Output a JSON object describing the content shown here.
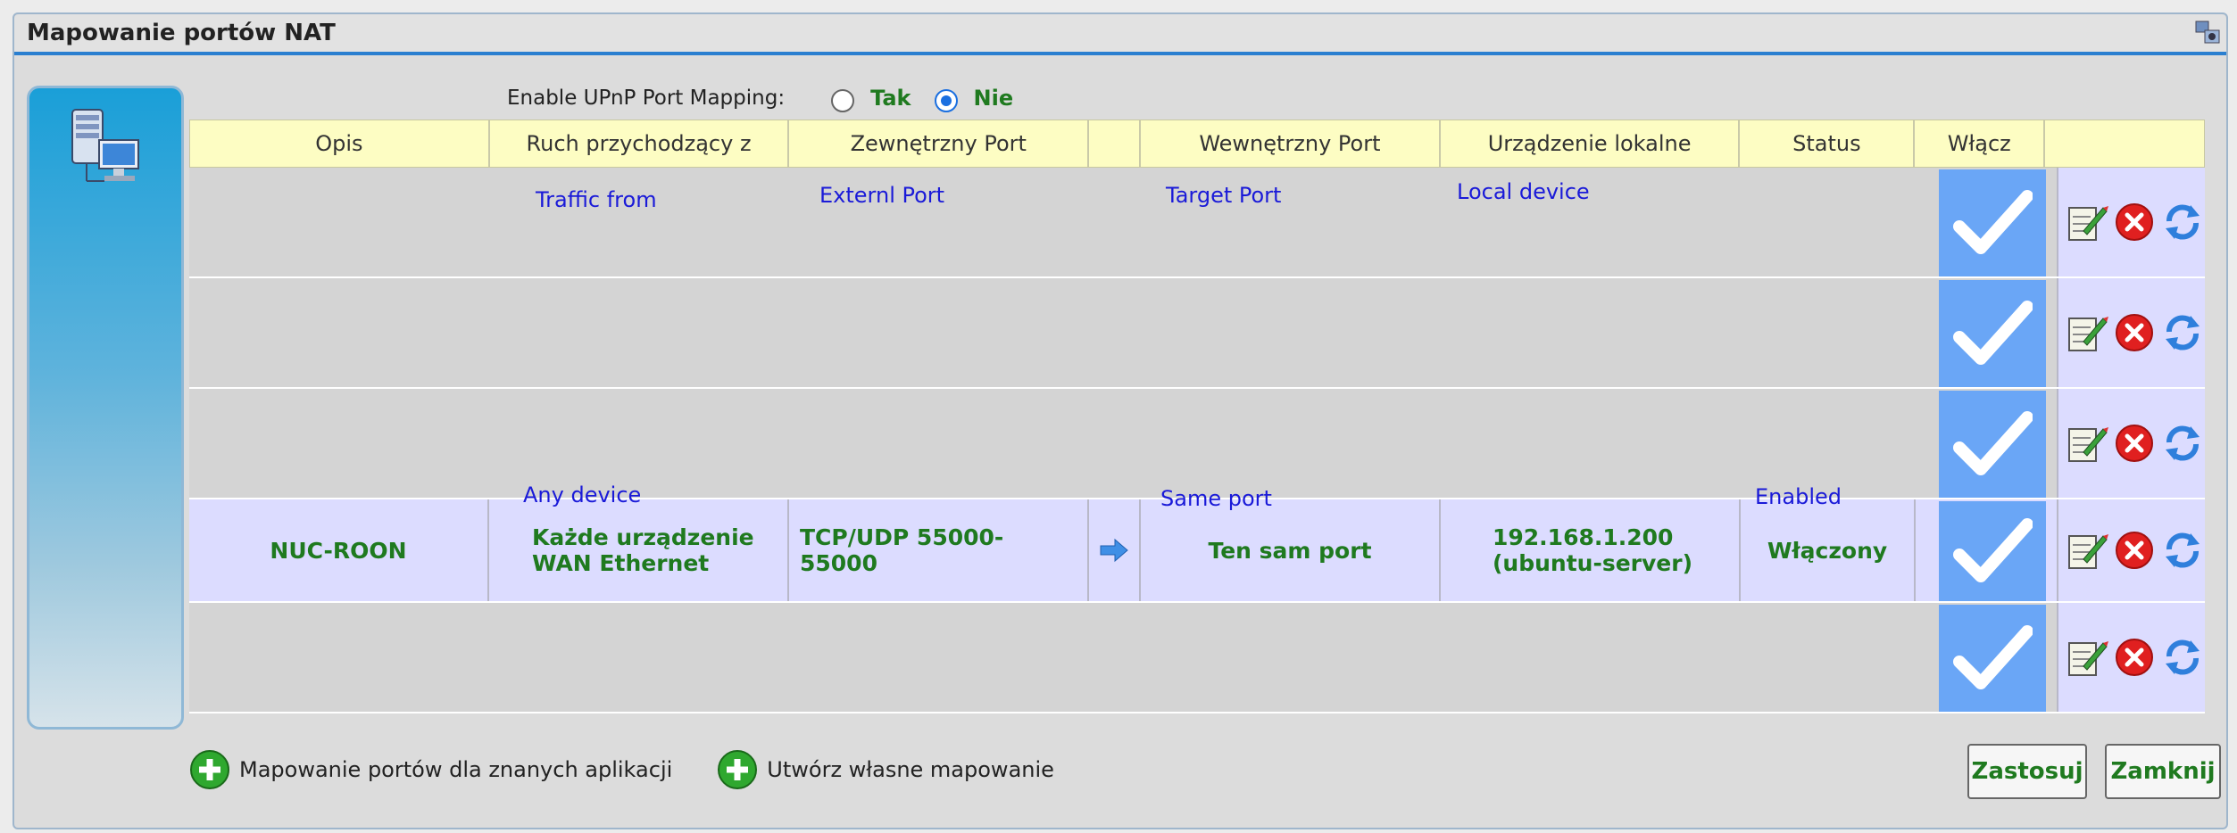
{
  "window": {
    "title": "Mapowanie portów NAT"
  },
  "upnp": {
    "label": "Enable UPnP Port Mapping:",
    "opt_yes": "Tak",
    "opt_no": "Nie",
    "selected": "Nie"
  },
  "table": {
    "headers": [
      "Opis",
      "Ruch przychodzący z",
      "Zewnętrzny Port",
      "",
      "Wewnętrzny Port",
      "Urządzenie lokalne",
      "Status",
      "Włącz",
      ""
    ],
    "row": {
      "description": "NUC-ROON",
      "incoming_line1": "Każde urządzenie",
      "incoming_line2": "WAN Ethernet",
      "external_line1": "TCP/UDP 55000-",
      "external_line2": "55000",
      "internal": "Ten sam port",
      "device_line1": "192.168.1.200",
      "device_line2": "(ubuntu-server)",
      "status": "Włączony"
    }
  },
  "hints": {
    "traffic_from": "Traffic from",
    "external_port": "Externl Port",
    "target_port": "Target Port",
    "local_device": "Local device",
    "any_device": "Any device",
    "same_port": "Same port",
    "enabled": "Enabled"
  },
  "bottom": {
    "known_apps": "Mapowanie portów dla znanych aplikacji",
    "custom": "Utwórz własne mapowanie",
    "apply": "Zastosuj",
    "close": "Zamknij"
  },
  "colors": {
    "accent": "#2a7fd0",
    "green_text": "#1f7a1f",
    "header_bg": "#fdfdc3",
    "hint_blue": "#1a1ad8",
    "check_bg": "#6aa6f6"
  }
}
